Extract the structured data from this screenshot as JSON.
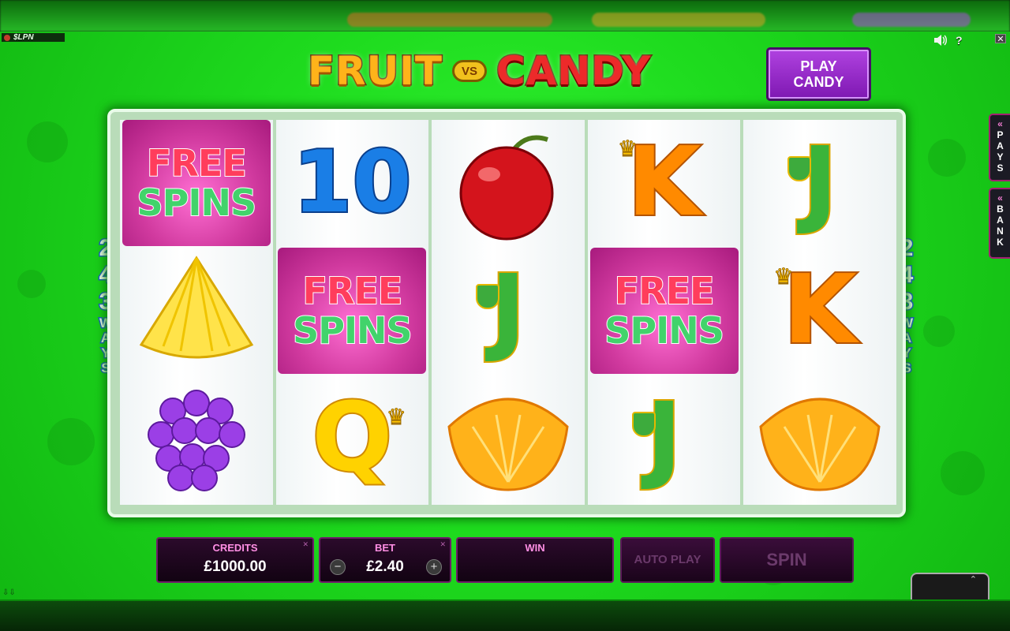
{
  "top_bar": {
    "brand_text": "$LPN",
    "sound_icon": "speaker-icon",
    "help_label": "?",
    "close_label": "✕"
  },
  "logo": {
    "fruit": "FRUIT",
    "vs": "VS",
    "candy": "CANDY"
  },
  "play_candy_button": {
    "line1": "PLAY",
    "line2": "CANDY"
  },
  "ways": {
    "number_digits": [
      "2",
      "4",
      "3"
    ],
    "word": [
      "W",
      "A",
      "Y",
      "S"
    ]
  },
  "reels": [
    [
      {
        "symbol": "free-spins",
        "text": [
          "FREE",
          "SPINS"
        ]
      },
      {
        "symbol": "pineapple"
      },
      {
        "symbol": "grapes"
      }
    ],
    [
      {
        "symbol": "ten",
        "text": "10"
      },
      {
        "symbol": "free-spins",
        "text": [
          "FREE",
          "SPINS"
        ]
      },
      {
        "symbol": "queen",
        "text": "Q"
      }
    ],
    [
      {
        "symbol": "cherry"
      },
      {
        "symbol": "jack",
        "text": "J"
      },
      {
        "symbol": "orange-slice"
      }
    ],
    [
      {
        "symbol": "king",
        "text": "K"
      },
      {
        "symbol": "free-spins",
        "text": [
          "FREE",
          "SPINS"
        ]
      },
      {
        "symbol": "jack",
        "text": "J"
      }
    ],
    [
      {
        "symbol": "jack",
        "text": "J"
      },
      {
        "symbol": "king",
        "text": "K"
      },
      {
        "symbol": "orange-slice"
      }
    ]
  ],
  "side_tabs": {
    "pays": [
      "P",
      "A",
      "Y",
      "S"
    ],
    "bank": [
      "B",
      "A",
      "N",
      "K"
    ]
  },
  "controls": {
    "credits_label": "CREDITS",
    "credits_value": "£1000.00",
    "bet_label": "BET",
    "bet_value": "£2.40",
    "win_label": "WIN",
    "win_value": "",
    "autoplay_label": "AUTO PLAY",
    "spin_label": "SPIN"
  }
}
